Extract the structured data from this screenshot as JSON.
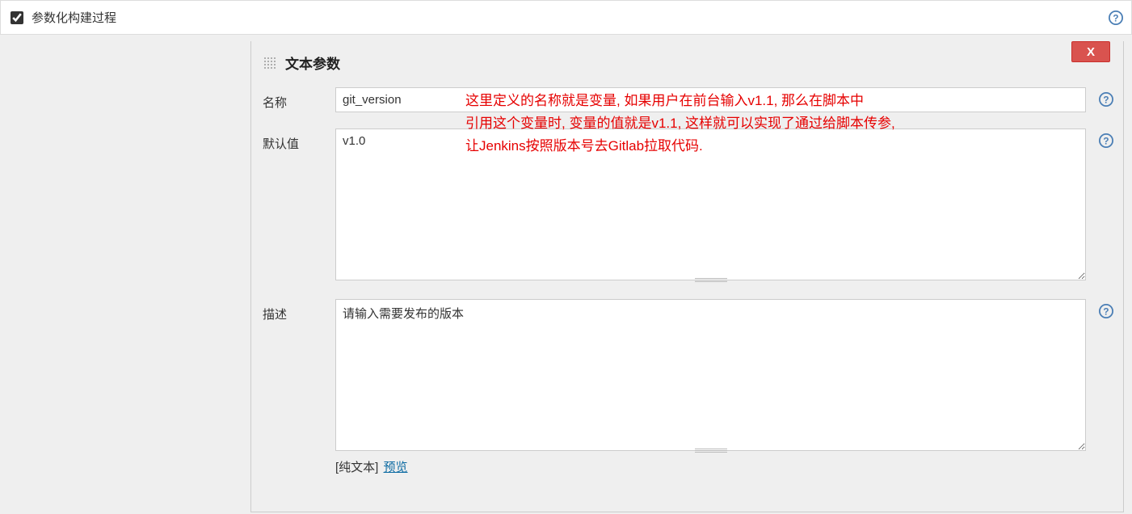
{
  "top": {
    "checkbox_label": "参数化构建过程"
  },
  "param": {
    "title": "文本参数",
    "close_label": "X",
    "fields": {
      "name": {
        "label": "名称",
        "value": "git_version"
      },
      "default": {
        "label": "默认值",
        "value": "v1.0"
      },
      "description": {
        "label": "描述",
        "value": "请输入需要发布的版本 "
      }
    },
    "footer": {
      "plain_text_label": "[纯文本]",
      "preview_label": "预览"
    }
  },
  "annotation": {
    "line1": "这里定义的名称就是变量, 如果用户在前台输入v1.1, 那么在脚本中",
    "line2": "引用这个变量时, 变量的值就是v1.1, 这样就可以实现了通过给脚本传参,",
    "line3": "让Jenkins按照版本号去Gitlab拉取代码."
  },
  "icons": {
    "help": "help-icon",
    "drag": "drag-handle-icon",
    "close": "close-icon"
  }
}
